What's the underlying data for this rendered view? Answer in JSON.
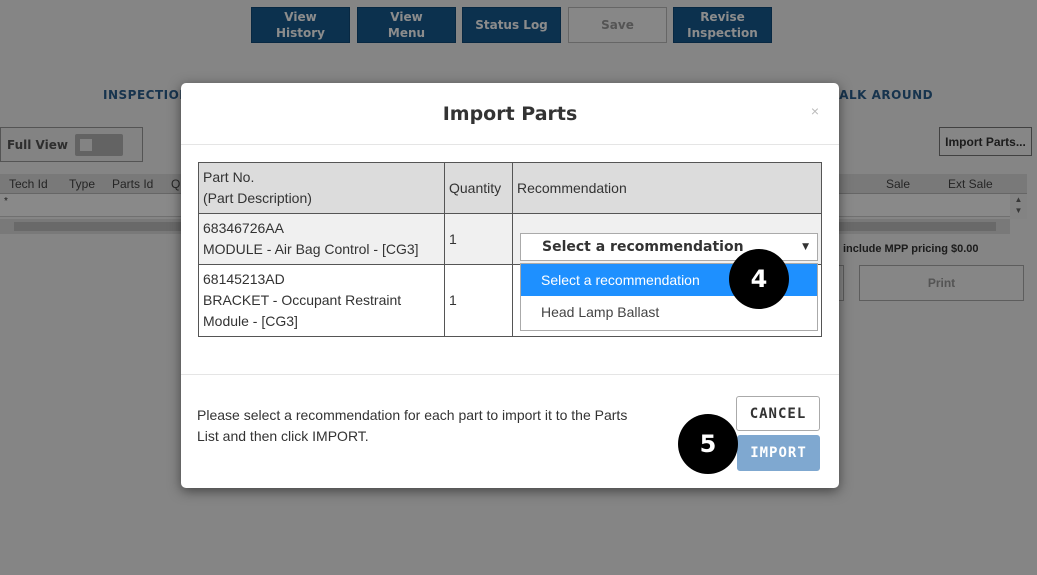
{
  "toolbar": {
    "view_history": "View\nHistory",
    "view_menu": "View\nMenu",
    "status_log": "Status Log",
    "save": "Save",
    "revise_inspection": "Revise\nInspection"
  },
  "page": {
    "section_left": "INSPECTION",
    "section_right": "WALK AROUND",
    "full_view_label": "Full View",
    "import_parts_button": "Import Parts...",
    "grid_columns": [
      "Tech Id",
      "Type",
      "Parts Id",
      "Q",
      "Sale",
      "Ext Sale"
    ],
    "grid_new_row_marker": "*",
    "mpp_text": "include MPP pricing  $0.00",
    "print_button": "Print"
  },
  "modal": {
    "title": "Import Parts",
    "close_symbol": "×",
    "table_headers": {
      "part": "Part No.\n(Part Description)",
      "quantity": "Quantity",
      "recommendation": "Recommendation"
    },
    "rows": [
      {
        "part_no": "68346726AA",
        "description": "MODULE - Air Bag Control - [CG3]",
        "quantity": "1"
      },
      {
        "part_no": "68145213AD",
        "description": "BRACKET - Occupant Restraint Module - [CG3]",
        "quantity": "1"
      }
    ],
    "select_value": "Select a recommendation",
    "dropdown_options": [
      "Select a recommendation",
      "Head Lamp Ballast"
    ],
    "footer_message": "Please select a recommendation for each part to import it to the Parts List and then click IMPORT.",
    "cancel_label": "CANCEL",
    "import_label": "IMPORT"
  },
  "steps": {
    "step4": "4",
    "step5": "5"
  },
  "colors": {
    "primary": "#17598e",
    "dropdown_selected": "#1e90ff",
    "import_button": "#7fa8d0"
  }
}
